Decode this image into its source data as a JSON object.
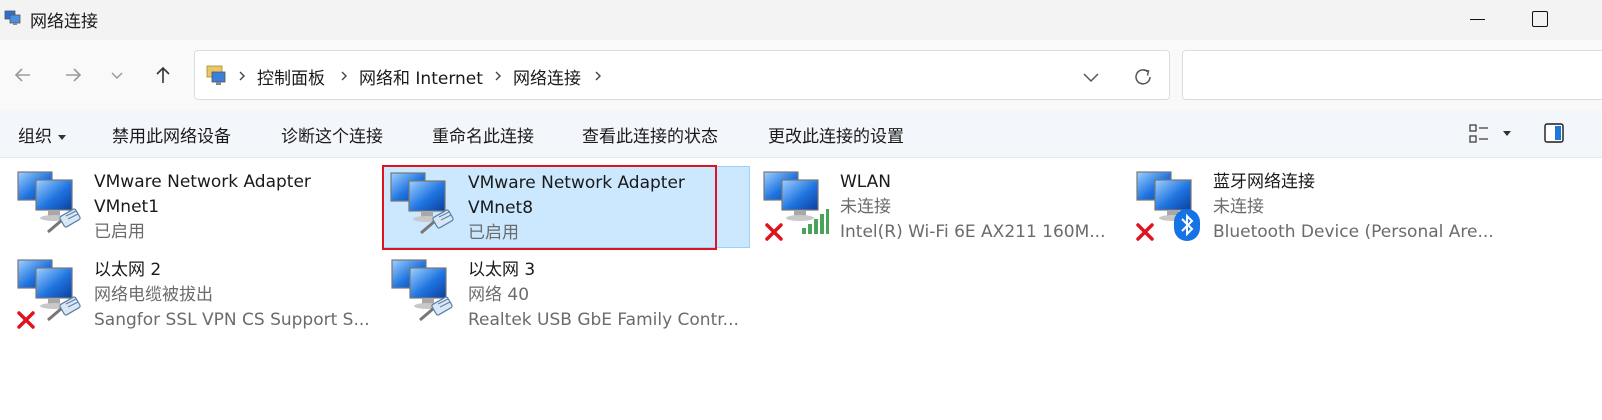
{
  "window": {
    "title": "网络连接",
    "icons": [
      "network-connections-icon",
      "minimize-icon",
      "maximize-icon"
    ]
  },
  "nav": {
    "back_icon": "back-arrow-icon",
    "forward_icon": "forward-arrow-icon",
    "recent_icon": "chevron-down-icon",
    "up_icon": "up-arrow-icon",
    "breadcrumbs": [
      "控制面板",
      "网络和 Internet",
      "网络连接"
    ],
    "search_placeholder": ""
  },
  "commands": {
    "organize": "组织",
    "disable": "禁用此网络设备",
    "diagnose": "诊断这个连接",
    "rename": "重命名此连接",
    "view_status": "查看此连接的状态",
    "change_settings": "更改此连接的设置"
  },
  "connections": [
    {
      "name": "VMware Network Adapter",
      "name2": "VMnet1",
      "status": "已启用",
      "device": "",
      "badge": "ethernet-plug-icon",
      "selected": false
    },
    {
      "name": "VMware Network Adapter",
      "name2": "VMnet8",
      "status": "已启用",
      "device": "",
      "badge": "ethernet-plug-icon",
      "selected": true
    },
    {
      "name": "WLAN",
      "name2": "",
      "status": "未连接",
      "device": "Intel(R) Wi-Fi 6E AX211 160M...",
      "badge": "wifi-signal-icon",
      "error": true,
      "selected": false
    },
    {
      "name": "蓝牙网络连接",
      "name2": "",
      "status": "未连接",
      "device": "Bluetooth Device (Personal Are...",
      "badge": "bluetooth-icon",
      "error": true,
      "selected": false
    },
    {
      "name": "以太网 2",
      "name2": "",
      "status": "网络电缆被拔出",
      "device": "Sangfor SSL VPN CS Support S...",
      "badge": "ethernet-plug-icon",
      "error": true,
      "selected": false
    },
    {
      "name": "以太网 3",
      "name2": "",
      "status": "网络 40",
      "device": "Realtek USB GbE Family Contr...",
      "badge": "ethernet-plug-icon",
      "selected": false
    }
  ],
  "colors": {
    "selection_bg": "#cce8ff",
    "selection_border": "#99d1ff",
    "highlight_outline": "#e0141e",
    "command_bar_bg": "#f3f6fb"
  }
}
